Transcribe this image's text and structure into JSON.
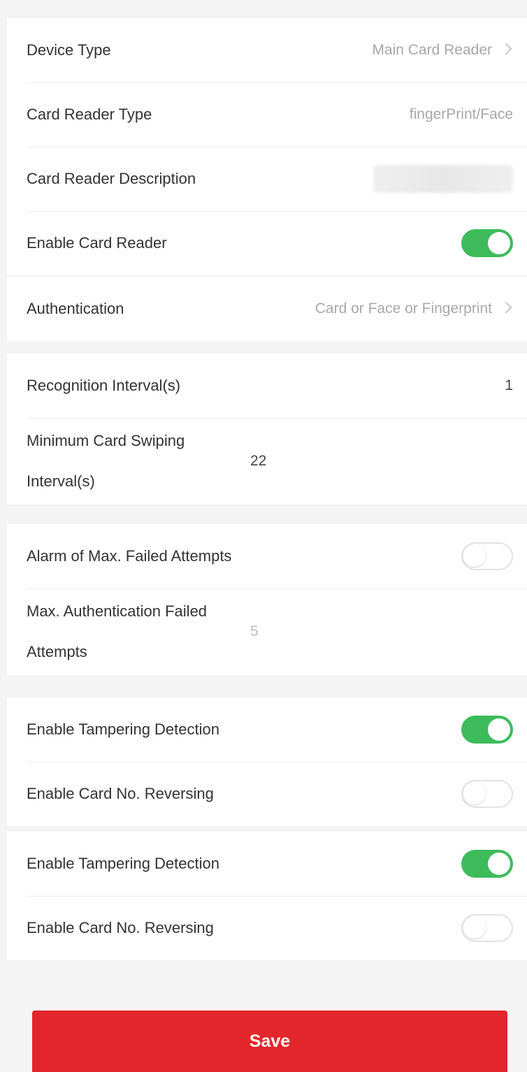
{
  "device": {
    "device_type_label": "Device Type",
    "device_type_value": "Main Card Reader",
    "card_reader_type_label": "Card Reader Type",
    "card_reader_type_value": "fingerPrint/Face",
    "card_reader_description_label": "Card Reader Description",
    "enable_card_reader_label": "Enable Card Reader",
    "enable_card_reader_on": true
  },
  "auth": {
    "authentication_label": "Authentication",
    "authentication_value": "Card or Face or Fingerprint"
  },
  "intervals": {
    "recognition_interval_label": "Recognition Interval(s)",
    "recognition_interval_value": "1",
    "min_swipe_interval_label": "Minimum Card Swiping Interval(s)",
    "min_swipe_interval_value": "22"
  },
  "alarm": {
    "alarm_failed_label": "Alarm of Max. Failed Attempts",
    "alarm_failed_on": false,
    "max_failed_label": "Max. Authentication Failed Attempts",
    "max_failed_value": "5"
  },
  "tamper_group_1": {
    "tampering_label": "Enable Tampering Detection",
    "tampering_on": true,
    "reversing_label": "Enable Card No. Reversing",
    "reversing_on": false
  },
  "tamper_group_2": {
    "tampering_label": "Enable Tampering Detection",
    "tampering_on": true,
    "reversing_label": "Enable Card No. Reversing",
    "reversing_on": false
  },
  "actions": {
    "save_label": "Save"
  },
  "colors": {
    "accent_save": "#e3262b",
    "toggle_on": "#3dbb5b"
  }
}
